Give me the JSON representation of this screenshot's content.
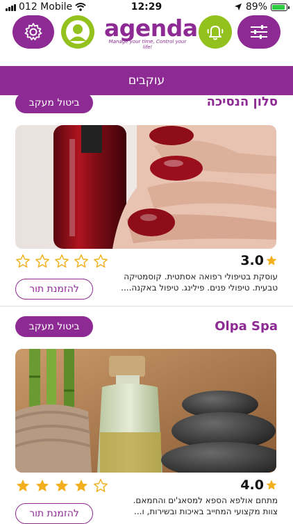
{
  "status": {
    "carrier": "012 Mobile",
    "time": "12:29",
    "battery": "89%",
    "battery_level": 0.89
  },
  "header": {
    "logo_text": "agenda",
    "tagline": "Manage your time, Control your life!"
  },
  "page_title": "עוקבים",
  "cards": [
    {
      "name": "סלון הנסיכה",
      "unfollow_label": "ביטול מעקב",
      "rating": "3.0",
      "stars_filled": 0,
      "description_line1": "עוסקת בטיפולי רפואה אסתטית. קוסמטיקה",
      "description_line2": "טבעית. טיפולי פנים. פילינג. טיפול באקנה....",
      "book_label": "להזמנת תור"
    },
    {
      "name": "Olpa Spa",
      "unfollow_label": "ביטול מעקב",
      "rating": "4.0",
      "stars_filled": 4,
      "description_line1": "מתחם אולפא הספא למסאג'ים והחמאם.",
      "description_line2": "צוות מקצועי המחייב באיכות ובשירות, ו...",
      "book_label": "להזמנת תור"
    }
  ],
  "colors": {
    "brand_purple": "#8d2a93",
    "accent_green": "#93c11e",
    "star_gold": "#f2b01e"
  },
  "icons": [
    "gear-icon",
    "user-icon",
    "bell-icon",
    "sliders-icon",
    "wifi-icon",
    "location-arrow-icon",
    "battery-icon",
    "star-icon"
  ]
}
